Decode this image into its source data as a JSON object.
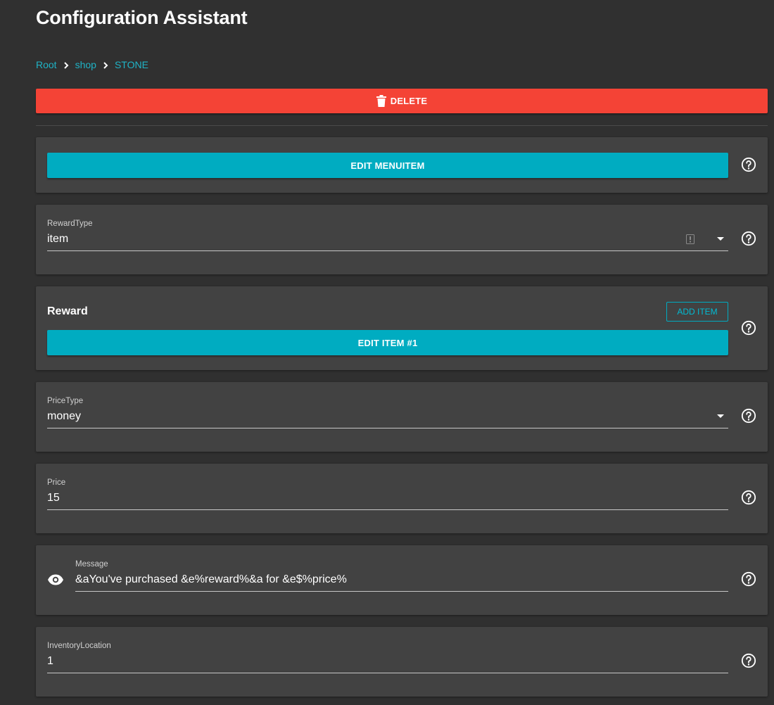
{
  "header": {
    "title": "Configuration Assistant"
  },
  "breadcrumb": {
    "items": [
      "Root",
      "shop",
      "STONE"
    ]
  },
  "actions": {
    "delete_label": "DELETE"
  },
  "menuitem": {
    "edit_label": "EDIT MENUITEM"
  },
  "reward_type": {
    "label": "RewardType",
    "value": "item"
  },
  "reward": {
    "title": "Reward",
    "add_label": "ADD ITEM",
    "edit_label": "EDIT ITEM #1"
  },
  "price_type": {
    "label": "PriceType",
    "value": "money"
  },
  "price": {
    "label": "Price",
    "value": "15"
  },
  "message": {
    "label": "Message",
    "value": "&aYou've purchased &e%reward%&a for &e$%price%"
  },
  "inventory_location": {
    "label": "InventoryLocation",
    "value": "1"
  },
  "colors": {
    "background": "#303030",
    "card": "#424242",
    "danger": "#f44336",
    "accent": "#00acc1",
    "link": "#1fb3c6"
  },
  "icons": {
    "help": "help-circle-icon",
    "delete": "trash-icon",
    "visibility": "eye-icon",
    "dropdown": "caret-down-icon",
    "breadcrumb_separator": "chevron-right-icon"
  }
}
